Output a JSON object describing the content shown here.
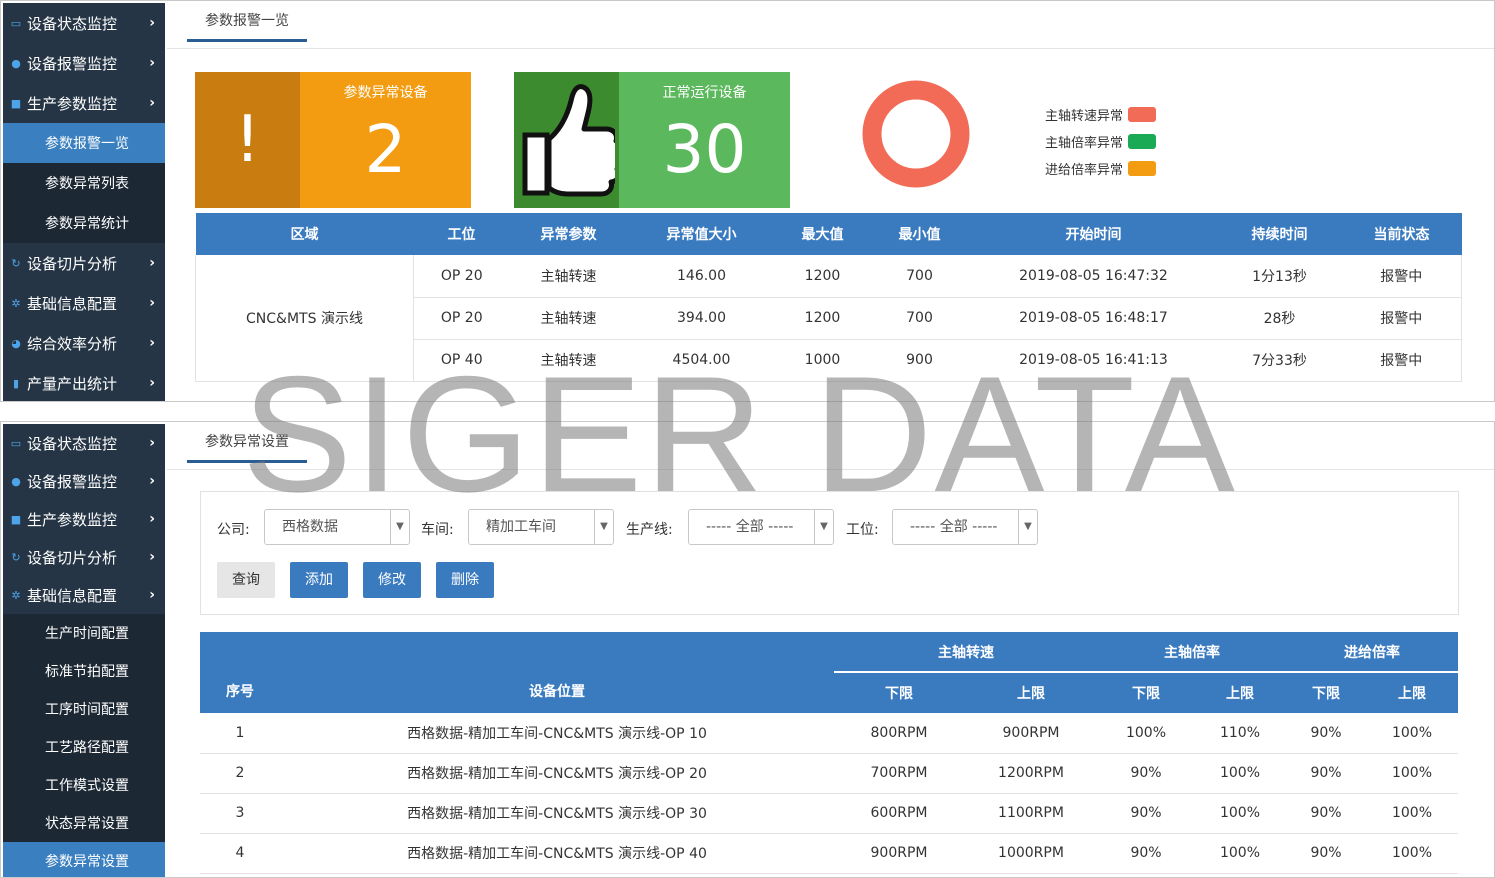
{
  "top": {
    "sidebar": [
      {
        "label": "设备状态监控",
        "icon": "monitor-icon"
      },
      {
        "label": "设备报警监控",
        "icon": "bell-icon"
      },
      {
        "label": "生产参数监控",
        "icon": "sitemap-icon"
      }
    ],
    "sidebar_sub": [
      "参数报警一览",
      "参数异常列表",
      "参数异常统计"
    ],
    "sidebar_after": [
      {
        "label": "设备切片分析",
        "icon": "refresh-icon"
      },
      {
        "label": "基础信息配置",
        "icon": "gear-icon"
      },
      {
        "label": "综合效率分析",
        "icon": "pie-icon"
      },
      {
        "label": "产量产出统计",
        "icon": "bar-chart-icon"
      }
    ],
    "tab": "参数报警一览",
    "card_abnormal": {
      "title": "参数异常设备",
      "value": "2",
      "symbol": "!"
    },
    "card_normal": {
      "title": "正常运行设备",
      "value": "30"
    },
    "legend": [
      {
        "label": "主轴转速异常",
        "color": "#f26b57"
      },
      {
        "label": "主轴倍率异常",
        "color": "#1aaa55"
      },
      {
        "label": "进给倍率异常",
        "color": "#f39c12"
      }
    ],
    "ring_color": "#f26b57",
    "table_headers": [
      "区域",
      "工位",
      "异常参数",
      "异常值大小",
      "最大值",
      "最小值",
      "开始时间",
      "持续时间",
      "当前状态"
    ],
    "zone": "CNC&MTS 演示线",
    "rows": [
      [
        "OP 20",
        "主轴转速",
        "146.00",
        "1200",
        "700",
        "2019-08-05 16:47:32",
        "1分13秒",
        "报警中"
      ],
      [
        "OP 20",
        "主轴转速",
        "394.00",
        "1200",
        "700",
        "2019-08-05 16:48:17",
        "28秒",
        "报警中"
      ],
      [
        "OP 40",
        "主轴转速",
        "4504.00",
        "1000",
        "900",
        "2019-08-05 16:41:13",
        "7分33秒",
        "报警中"
      ]
    ]
  },
  "bottom": {
    "sidebar": [
      {
        "label": "设备状态监控",
        "icon": "monitor-icon"
      },
      {
        "label": "设备报警监控",
        "icon": "bell-icon"
      },
      {
        "label": "生产参数监控",
        "icon": "sitemap-icon"
      },
      {
        "label": "设备切片分析",
        "icon": "refresh-icon"
      },
      {
        "label": "基础信息配置",
        "icon": "gear-icon"
      }
    ],
    "sidebar_sub": [
      "生产时间配置",
      "标准节拍配置",
      "工序时间配置",
      "工艺路径配置",
      "工作模式设置",
      "状态异常设置",
      "参数异常设置"
    ],
    "tab": "参数异常设置",
    "filters": {
      "company_label": "公司:",
      "company_value": "西格数据",
      "workshop_label": "车间:",
      "workshop_value": "精加工车间",
      "line_label": "生产线:",
      "line_value": "----- 全部 -----",
      "station_label": "工位:",
      "station_value": "----- 全部 -----"
    },
    "buttons": {
      "query": "查询",
      "add": "添加",
      "edit": "修改",
      "delete": "删除"
    },
    "group_headers": {
      "spindle_speed": "主轴转速",
      "spindle_ratio": "主轴倍率",
      "feed_ratio": "进给倍率"
    },
    "sub_headers": {
      "seq": "序号",
      "location": "设备位置",
      "lower": "下限",
      "upper": "上限"
    },
    "rows": [
      [
        "1",
        "西格数据-精加工车间-CNC&MTS 演示线-OP 10",
        "800RPM",
        "900RPM",
        "100%",
        "110%",
        "90%",
        "100%"
      ],
      [
        "2",
        "西格数据-精加工车间-CNC&MTS 演示线-OP 20",
        "700RPM",
        "1200RPM",
        "90%",
        "100%",
        "90%",
        "100%"
      ],
      [
        "3",
        "西格数据-精加工车间-CNC&MTS 演示线-OP 30",
        "600RPM",
        "1100RPM",
        "90%",
        "100%",
        "90%",
        "100%"
      ],
      [
        "4",
        "西格数据-精加工车间-CNC&MTS 演示线-OP 40",
        "900RPM",
        "1000RPM",
        "90%",
        "100%",
        "90%",
        "100%"
      ]
    ]
  },
  "watermark": "SIGER DATA"
}
